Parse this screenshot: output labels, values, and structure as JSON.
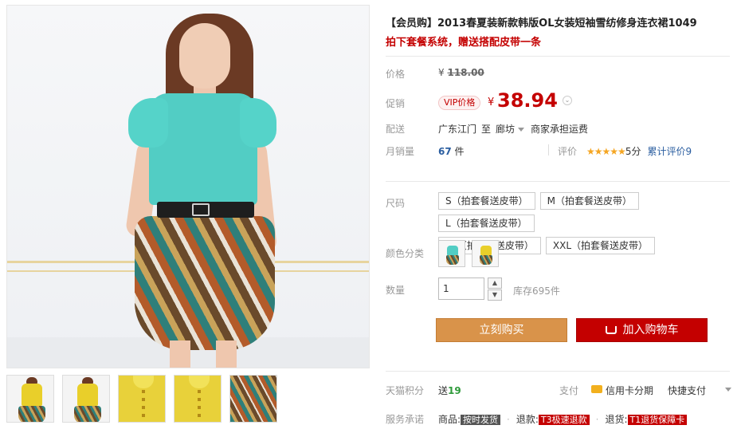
{
  "title": "【会员购】2013春夏装新款韩版OL女装短袖雪纺修身连衣裙1049",
  "promo": "拍下套餐系统，赠送搭配皮带一条",
  "price": {
    "label": "价格",
    "currency": "¥",
    "original": "118.00"
  },
  "promotion": {
    "label": "促销",
    "vip_badge": "VIP价格",
    "currency": "¥",
    "value": "38.94"
  },
  "shipping": {
    "label": "配送",
    "from": "广东江门",
    "to_word": "至",
    "destination": "廊坊",
    "fee": "商家承担运费"
  },
  "sales": {
    "label": "月销量",
    "count": "67",
    "unit": "件",
    "review_label": "评价",
    "stars": "★★★★★",
    "score": "5分",
    "review_count": "累计评价9"
  },
  "size": {
    "label": "尺码",
    "options": [
      "S（拍套餐送皮带）",
      "M（拍套餐送皮带）",
      "L（拍套餐送皮带）",
      "XL（拍套餐送皮带）",
      "XXL（拍套餐送皮带）"
    ]
  },
  "color": {
    "label": "颜色分类",
    "swatches": [
      {
        "top_color": "#52cdc4"
      },
      {
        "top_color": "#e9cf2a"
      }
    ]
  },
  "quantity": {
    "label": "数量",
    "value": "1",
    "stock": "库存695件"
  },
  "buttons": {
    "buy_now": "立刻购买",
    "add_cart": "加入购物车"
  },
  "points": {
    "label": "天猫积分",
    "prefix": "送",
    "value": "19"
  },
  "payment": {
    "label": "支付",
    "card": "信用卡分期",
    "quick": "快捷支付"
  },
  "promise": {
    "label": "服务承诺",
    "goods_label": "商品:",
    "goods_tag": "按时发货",
    "refund_label": "退款:",
    "refund_tag": "T3极速退款",
    "return_label": "退货:",
    "return_tag": "T1退货保障卡"
  },
  "colors": {
    "accent": "#c40000",
    "buy_button": "#d9934a",
    "link": "#2b5ea0"
  }
}
